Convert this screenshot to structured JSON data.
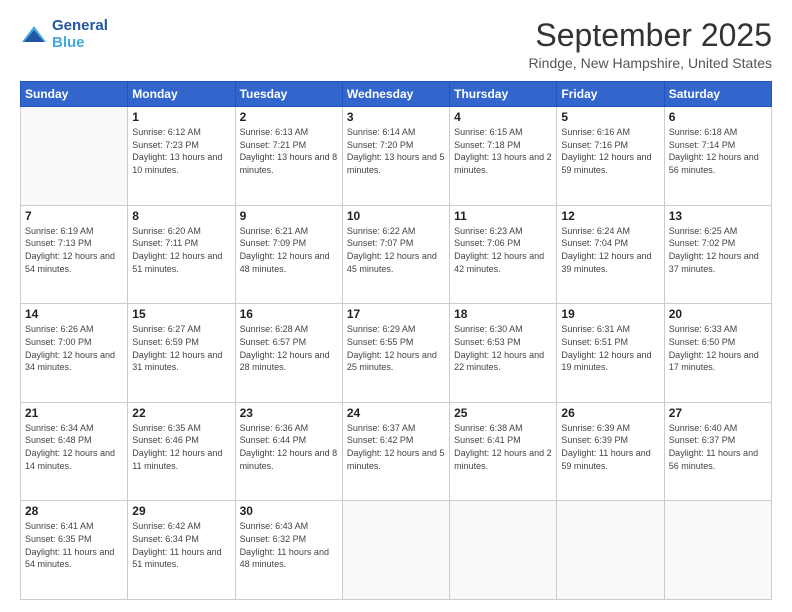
{
  "logo": {
    "line1": "General",
    "line2": "Blue"
  },
  "title": "September 2025",
  "location": "Rindge, New Hampshire, United States",
  "days_of_week": [
    "Sunday",
    "Monday",
    "Tuesday",
    "Wednesday",
    "Thursday",
    "Friday",
    "Saturday"
  ],
  "weeks": [
    [
      {
        "day": "",
        "sunrise": "",
        "sunset": "",
        "daylight": ""
      },
      {
        "day": "1",
        "sunrise": "Sunrise: 6:12 AM",
        "sunset": "Sunset: 7:23 PM",
        "daylight": "Daylight: 13 hours and 10 minutes."
      },
      {
        "day": "2",
        "sunrise": "Sunrise: 6:13 AM",
        "sunset": "Sunset: 7:21 PM",
        "daylight": "Daylight: 13 hours and 8 minutes."
      },
      {
        "day": "3",
        "sunrise": "Sunrise: 6:14 AM",
        "sunset": "Sunset: 7:20 PM",
        "daylight": "Daylight: 13 hours and 5 minutes."
      },
      {
        "day": "4",
        "sunrise": "Sunrise: 6:15 AM",
        "sunset": "Sunset: 7:18 PM",
        "daylight": "Daylight: 13 hours and 2 minutes."
      },
      {
        "day": "5",
        "sunrise": "Sunrise: 6:16 AM",
        "sunset": "Sunset: 7:16 PM",
        "daylight": "Daylight: 12 hours and 59 minutes."
      },
      {
        "day": "6",
        "sunrise": "Sunrise: 6:18 AM",
        "sunset": "Sunset: 7:14 PM",
        "daylight": "Daylight: 12 hours and 56 minutes."
      }
    ],
    [
      {
        "day": "7",
        "sunrise": "Sunrise: 6:19 AM",
        "sunset": "Sunset: 7:13 PM",
        "daylight": "Daylight: 12 hours and 54 minutes."
      },
      {
        "day": "8",
        "sunrise": "Sunrise: 6:20 AM",
        "sunset": "Sunset: 7:11 PM",
        "daylight": "Daylight: 12 hours and 51 minutes."
      },
      {
        "day": "9",
        "sunrise": "Sunrise: 6:21 AM",
        "sunset": "Sunset: 7:09 PM",
        "daylight": "Daylight: 12 hours and 48 minutes."
      },
      {
        "day": "10",
        "sunrise": "Sunrise: 6:22 AM",
        "sunset": "Sunset: 7:07 PM",
        "daylight": "Daylight: 12 hours and 45 minutes."
      },
      {
        "day": "11",
        "sunrise": "Sunrise: 6:23 AM",
        "sunset": "Sunset: 7:06 PM",
        "daylight": "Daylight: 12 hours and 42 minutes."
      },
      {
        "day": "12",
        "sunrise": "Sunrise: 6:24 AM",
        "sunset": "Sunset: 7:04 PM",
        "daylight": "Daylight: 12 hours and 39 minutes."
      },
      {
        "day": "13",
        "sunrise": "Sunrise: 6:25 AM",
        "sunset": "Sunset: 7:02 PM",
        "daylight": "Daylight: 12 hours and 37 minutes."
      }
    ],
    [
      {
        "day": "14",
        "sunrise": "Sunrise: 6:26 AM",
        "sunset": "Sunset: 7:00 PM",
        "daylight": "Daylight: 12 hours and 34 minutes."
      },
      {
        "day": "15",
        "sunrise": "Sunrise: 6:27 AM",
        "sunset": "Sunset: 6:59 PM",
        "daylight": "Daylight: 12 hours and 31 minutes."
      },
      {
        "day": "16",
        "sunrise": "Sunrise: 6:28 AM",
        "sunset": "Sunset: 6:57 PM",
        "daylight": "Daylight: 12 hours and 28 minutes."
      },
      {
        "day": "17",
        "sunrise": "Sunrise: 6:29 AM",
        "sunset": "Sunset: 6:55 PM",
        "daylight": "Daylight: 12 hours and 25 minutes."
      },
      {
        "day": "18",
        "sunrise": "Sunrise: 6:30 AM",
        "sunset": "Sunset: 6:53 PM",
        "daylight": "Daylight: 12 hours and 22 minutes."
      },
      {
        "day": "19",
        "sunrise": "Sunrise: 6:31 AM",
        "sunset": "Sunset: 6:51 PM",
        "daylight": "Daylight: 12 hours and 19 minutes."
      },
      {
        "day": "20",
        "sunrise": "Sunrise: 6:33 AM",
        "sunset": "Sunset: 6:50 PM",
        "daylight": "Daylight: 12 hours and 17 minutes."
      }
    ],
    [
      {
        "day": "21",
        "sunrise": "Sunrise: 6:34 AM",
        "sunset": "Sunset: 6:48 PM",
        "daylight": "Daylight: 12 hours and 14 minutes."
      },
      {
        "day": "22",
        "sunrise": "Sunrise: 6:35 AM",
        "sunset": "Sunset: 6:46 PM",
        "daylight": "Daylight: 12 hours and 11 minutes."
      },
      {
        "day": "23",
        "sunrise": "Sunrise: 6:36 AM",
        "sunset": "Sunset: 6:44 PM",
        "daylight": "Daylight: 12 hours and 8 minutes."
      },
      {
        "day": "24",
        "sunrise": "Sunrise: 6:37 AM",
        "sunset": "Sunset: 6:42 PM",
        "daylight": "Daylight: 12 hours and 5 minutes."
      },
      {
        "day": "25",
        "sunrise": "Sunrise: 6:38 AM",
        "sunset": "Sunset: 6:41 PM",
        "daylight": "Daylight: 12 hours and 2 minutes."
      },
      {
        "day": "26",
        "sunrise": "Sunrise: 6:39 AM",
        "sunset": "Sunset: 6:39 PM",
        "daylight": "Daylight: 11 hours and 59 minutes."
      },
      {
        "day": "27",
        "sunrise": "Sunrise: 6:40 AM",
        "sunset": "Sunset: 6:37 PM",
        "daylight": "Daylight: 11 hours and 56 minutes."
      }
    ],
    [
      {
        "day": "28",
        "sunrise": "Sunrise: 6:41 AM",
        "sunset": "Sunset: 6:35 PM",
        "daylight": "Daylight: 11 hours and 54 minutes."
      },
      {
        "day": "29",
        "sunrise": "Sunrise: 6:42 AM",
        "sunset": "Sunset: 6:34 PM",
        "daylight": "Daylight: 11 hours and 51 minutes."
      },
      {
        "day": "30",
        "sunrise": "Sunrise: 6:43 AM",
        "sunset": "Sunset: 6:32 PM",
        "daylight": "Daylight: 11 hours and 48 minutes."
      },
      {
        "day": "",
        "sunrise": "",
        "sunset": "",
        "daylight": ""
      },
      {
        "day": "",
        "sunrise": "",
        "sunset": "",
        "daylight": ""
      },
      {
        "day": "",
        "sunrise": "",
        "sunset": "",
        "daylight": ""
      },
      {
        "day": "",
        "sunrise": "",
        "sunset": "",
        "daylight": ""
      }
    ]
  ]
}
